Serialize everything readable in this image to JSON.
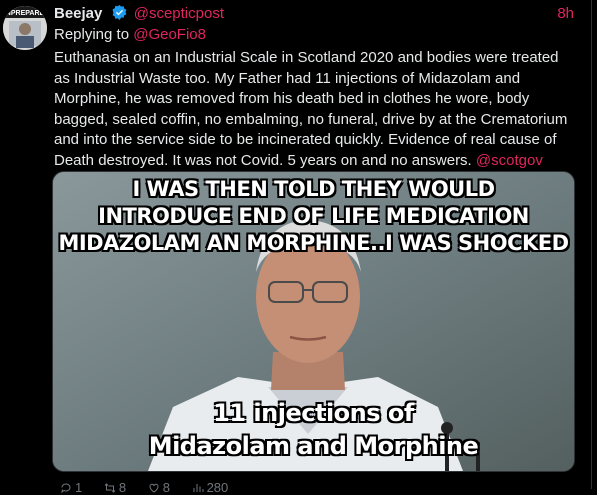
{
  "tweet": {
    "display_name": "Beejay",
    "handle": "@scepticpost",
    "time": "8h",
    "reply_prefix": "Replying to ",
    "reply_to": "@GeoFio8",
    "body": "Euthanasia on an Industrial Scale in Scotland 2020 and bodies were treated as Industrial Waste too. My Father had 11 injections of Midazolam and Morphine, he was removed from his death bed in clothes he wore, body bagged, sealed coffin, no embalming, no funeral, drive by at the Crematorium and into the service side to be incinerated quickly. Evidence of real cause of Death destroyed. It was not Covid. 5 years on and no answers. ",
    "body_mention": "@scotgov",
    "avatar_text": "UNPREPARED"
  },
  "media": {
    "caption_top_line1": "I WAS THEN TOLD THEY WOULD",
    "caption_top_line2": "INTRODUCE END OF LIFE MEDICATION",
    "caption_top_line3": "MIDAZOLAM AN MORPHINE..I WAS SHOCKED",
    "caption_bottom_line1": "11 injections of",
    "caption_bottom_line2": "Midazolam and Morphine"
  },
  "actions": {
    "replies": "1",
    "retweets": "8",
    "likes": "8",
    "views": "280"
  },
  "colors": {
    "accent": "#e0245e",
    "verified": "#1d9bf0",
    "background": "#000000"
  }
}
